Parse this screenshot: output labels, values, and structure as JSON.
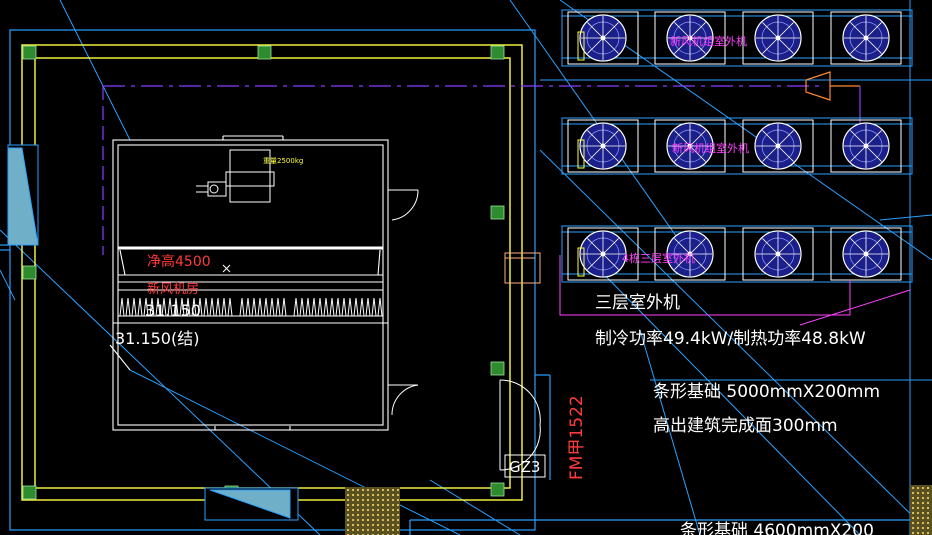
{
  "colors": {
    "background": "#000000",
    "wall": "#ffff40",
    "column": "#2e8b2e",
    "outline": "#ffffff",
    "blue_lines": "#2aa0ff",
    "duct": "#7a2cff",
    "red_label": "#ff3b3b",
    "pink_label": "#ff40ff",
    "hatch": "#b8a040"
  },
  "room": {
    "weight_label": "重量2500kg",
    "clear_height": "净高4500",
    "room_name": "新风机房",
    "elevation_top": "31.150",
    "elevation_bottom": "31.150(结)"
  },
  "units": [
    {
      "row": 1,
      "label": "新风机组室外机",
      "fans": 4
    },
    {
      "row": 2,
      "label": "新风机组室外机",
      "fans": 4
    },
    {
      "row": 3,
      "label": "4栋三层室外机",
      "fans": 4
    }
  ],
  "notes": {
    "title": "三层室外机",
    "power": "制冷功率49.4kW/制热功率48.8kW",
    "foundation": "条形基础 5000mmX200mm",
    "height_above": "高出建筑完成面300mm",
    "bottom_partial": "条形基础 4600mmX200"
  },
  "door_code": "FM甲1522",
  "column_code": "GZ3"
}
